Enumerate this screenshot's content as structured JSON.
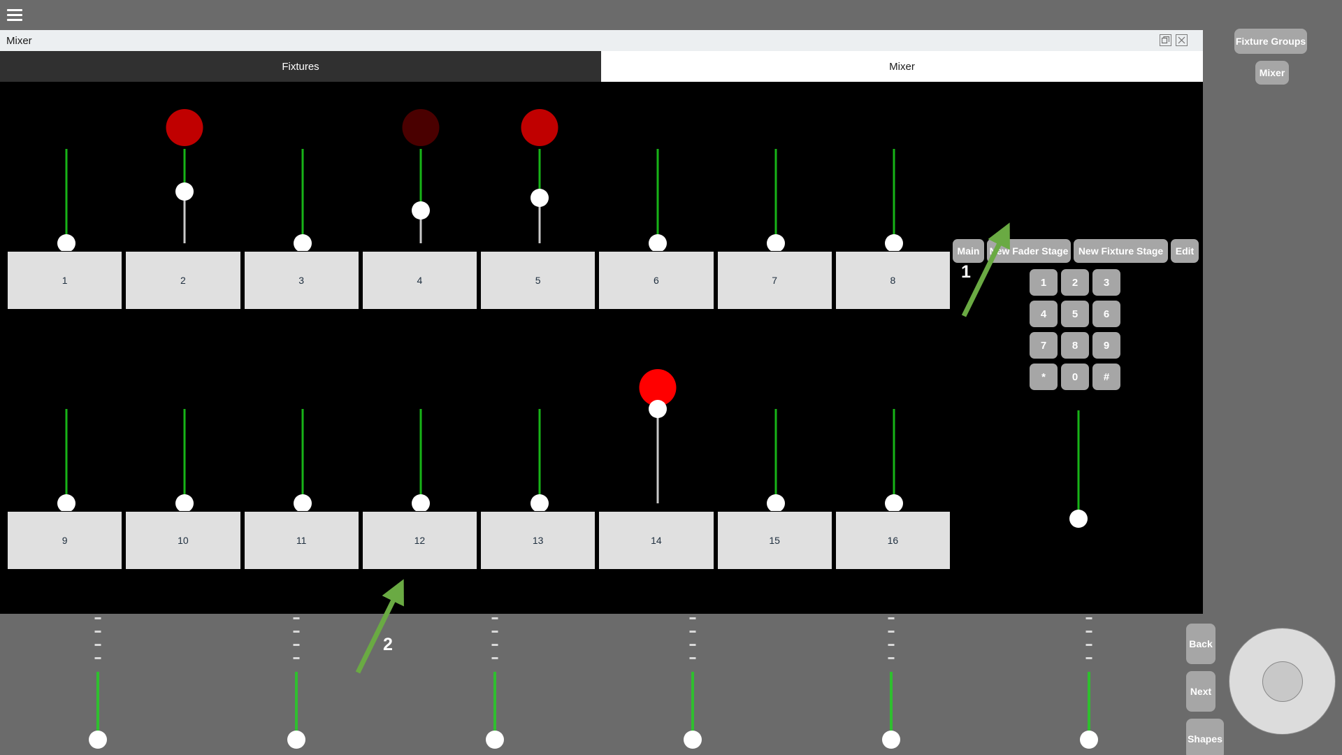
{
  "topbar": {
    "menu_icon": "hamburger-icon"
  },
  "window": {
    "title": "Mixer",
    "restore_icon": "restore-window-icon",
    "close_icon": "close-window-icon",
    "tabs": [
      {
        "label": "Fixtures",
        "active": true
      },
      {
        "label": "Mixer",
        "active": false
      }
    ]
  },
  "colors": {
    "green_track": "#17b317",
    "grey_track": "#c9c9c9",
    "knob": "#ffffff",
    "lamp_bright_red": "#ff0000",
    "lamp_red": "#c00000",
    "lamp_dark_red": "#4a0000",
    "panel_button": "#a6a6a6",
    "fixture_button": "#e0e0e0",
    "annotation_green": "#6aaa43",
    "stage_bg": "#000000",
    "app_bg": "#6b6b6b"
  },
  "fader_rows": [
    {
      "row": 1,
      "faders": [
        {
          "label": "1",
          "value": 0,
          "lamp": null
        },
        {
          "label": "2",
          "value": 55,
          "lamp": "#c00000"
        },
        {
          "label": "3",
          "value": 0,
          "lamp": null
        },
        {
          "label": "4",
          "value": 35,
          "lamp": "#4a0000"
        },
        {
          "label": "5",
          "value": 48,
          "lamp": "#c00000"
        },
        {
          "label": "6",
          "value": 0,
          "lamp": null
        },
        {
          "label": "7",
          "value": 0,
          "lamp": null
        },
        {
          "label": "8",
          "value": 0,
          "lamp": null
        }
      ]
    },
    {
      "row": 2,
      "faders": [
        {
          "label": "9",
          "value": 0,
          "lamp": null
        },
        {
          "label": "10",
          "value": 0,
          "lamp": null
        },
        {
          "label": "11",
          "value": 0,
          "lamp": null
        },
        {
          "label": "12",
          "value": 0,
          "lamp": null
        },
        {
          "label": "13",
          "value": 0,
          "lamp": null
        },
        {
          "label": "14",
          "value": 100,
          "lamp": "#ff0000"
        },
        {
          "label": "15",
          "value": 0,
          "lamp": null
        },
        {
          "label": "16",
          "value": 0,
          "lamp": null
        }
      ]
    }
  ],
  "control_panel": {
    "stage_buttons": [
      {
        "label": "Main"
      },
      {
        "label": "New Fader Stage"
      },
      {
        "label": "New Fixture Stage"
      },
      {
        "label": "Edit"
      }
    ],
    "keypad": [
      [
        "1",
        "2",
        "3"
      ],
      [
        "4",
        "5",
        "6"
      ],
      [
        "7",
        "8",
        "9"
      ],
      [
        "*",
        "0",
        "#"
      ]
    ],
    "master_fader": {
      "value": 0
    }
  },
  "right_sidebar": {
    "buttons": [
      {
        "label": "Fixture Groups"
      },
      {
        "label": "Mixer"
      }
    ]
  },
  "bottom_strip": {
    "dash_label": "-",
    "dash_rows": 4,
    "faders": [
      {
        "value": 0
      },
      {
        "value": 0
      },
      {
        "value": 0
      },
      {
        "value": 0
      },
      {
        "value": 0
      },
      {
        "value": 0
      }
    ]
  },
  "bottom_right_buttons": [
    {
      "label": "Back"
    },
    {
      "label": "Next"
    },
    {
      "label": "Shapes"
    }
  ],
  "jog_wheel": {
    "name": "jog-wheel"
  },
  "annotations": [
    {
      "number": "1",
      "target": "New Fader Stage"
    },
    {
      "number": "2",
      "target": "12"
    }
  ]
}
